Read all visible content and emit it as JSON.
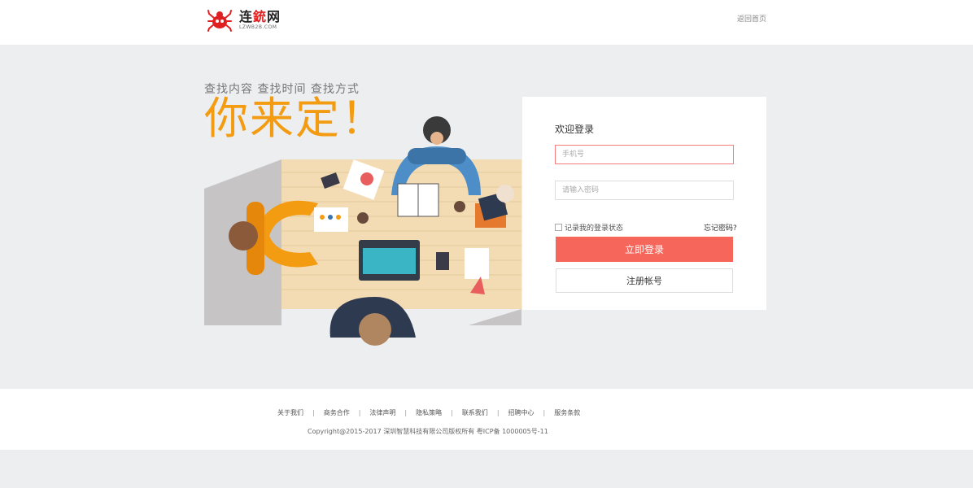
{
  "header": {
    "logo_name_black": "连",
    "logo_name_red": "銃",
    "logo_name_black2": "网",
    "logo_sub": "LZWB2B.COM",
    "back_home": "返回首页"
  },
  "hero": {
    "slogan_small": "查找内容  查找时间  查找方式",
    "slogan_big": "你来定！"
  },
  "login": {
    "welcome": "欢迎登录",
    "phone_placeholder": "手机号",
    "password_placeholder": "请输入密码",
    "remember_label": "记录我的登录状态",
    "forgot_label": "忘记密码?",
    "login_button": "立即登录",
    "register_button": "注册帐号"
  },
  "footer": {
    "links": [
      "关于我们",
      "商务合作",
      "法律声明",
      "隐私策略",
      "联系我们",
      "招聘中心",
      "服务条款"
    ],
    "separator": "|",
    "copyright": "Copyright@2015-2017 深圳智慧科技有限公司版权所有 粤ICP备 1000005号-11"
  },
  "colors": {
    "brand_red": "#e02020",
    "accent_orange": "#f39c12",
    "login_button": "#f7665a",
    "background": "#eceef0"
  },
  "icons": {
    "logo": "spider-logo-icon",
    "checkbox": "checkbox-icon"
  }
}
